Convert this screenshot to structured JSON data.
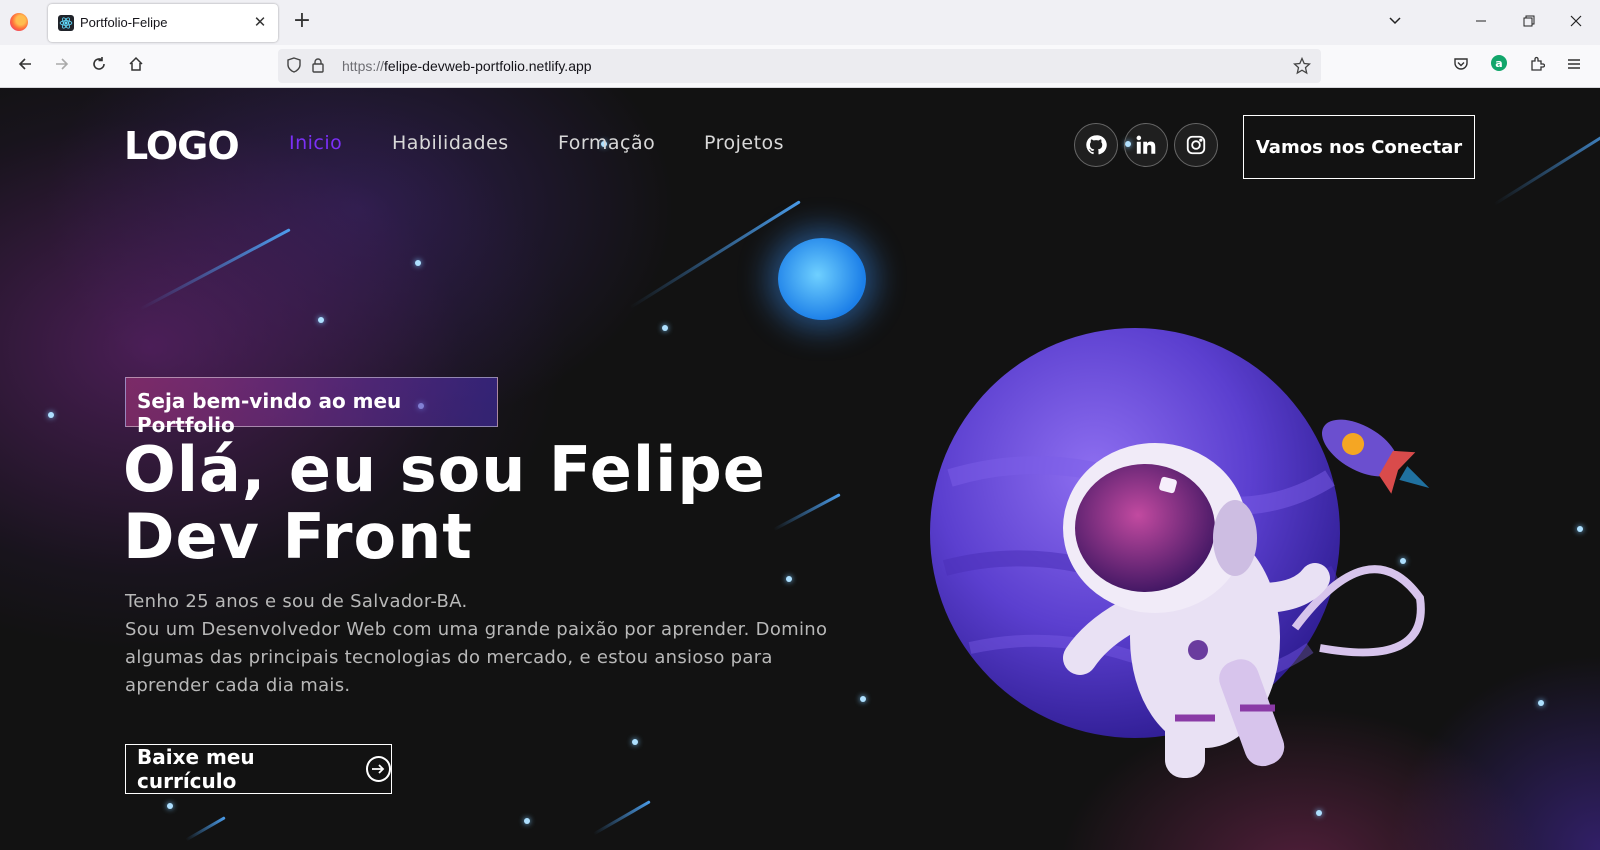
{
  "browser": {
    "tab_title": "Portfolio-Felipe",
    "tab_close": "✕",
    "new_tab": "+",
    "url_protocol": "https://",
    "url_host": "felipe-devweb-portfolio.netlify.app"
  },
  "site": {
    "logo": "LOGO",
    "nav": [
      "Inicio",
      "Habilidades",
      "Formação",
      "Projetos"
    ],
    "connect_label": "Vamos nos Conectar",
    "social": [
      "github-icon",
      "linkedin-icon",
      "instagram-icon"
    ]
  },
  "hero": {
    "tagline": "Seja bem-vindo ao meu Portfolio",
    "headline_line1": "Olá, eu sou Felipe",
    "headline_line2": "Dev Front",
    "bio_line1": "Tenho 25 anos e sou de Salvador-BA.",
    "bio_line2": "Sou um Desenvolvedor Web com uma grande paixão por aprender. Domino algumas das principais tecnologias do mercado, e estou ansioso para aprender cada dia mais.",
    "cv_button": "Baixe meu currículo"
  },
  "colors": {
    "accent": "#7b2ff7",
    "background": "#121212"
  }
}
